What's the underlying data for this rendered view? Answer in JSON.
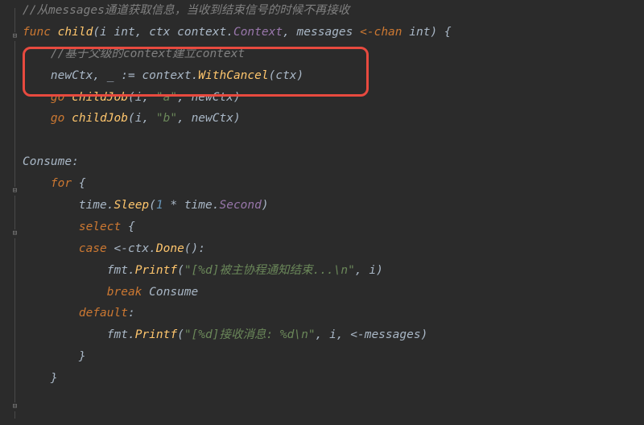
{
  "code": {
    "l5_comment": "//从messages通道获取信息，当收到结束信号的时候不再接收",
    "l6_func": "func",
    "l6_name": "child",
    "l6_p1": "i",
    "l6_t1": "int",
    "l6_p2": "ctx",
    "l6_t2a": "context",
    "l6_t2b": "Context",
    "l6_p3": "messages",
    "l6_chan": "<-chan",
    "l6_t3": "int",
    "l6_brace": ") {",
    "l7_comment": "//基于父级的context建立context",
    "l8_v1": "newCtx",
    "l8_v2": "_",
    "l8_op": ":=",
    "l8_pkg": "context",
    "l8_fn": "WithCancel",
    "l8_arg": "ctx",
    "l9_go": "go",
    "l9_fn": "childJob",
    "l9_a1": "i",
    "l9_a2": "\"a\"",
    "l9_a3": "newCtx",
    "l10_go": "go",
    "l10_fn": "childJob",
    "l10_a1": "i",
    "l10_a2": "\"b\"",
    "l10_a3": "newCtx",
    "l12_label": "Consume:",
    "l13_for": "for",
    "l13_brace": " {",
    "l14_pkg": "time",
    "l14_fn": "Sleep",
    "l14_n": "1",
    "l14_pkg2": "time",
    "l14_const": "Second",
    "l15_select": "select",
    "l15_brace": " {",
    "l16_case": "case",
    "l16_chan": " <-ctx.",
    "l16_done": "Done",
    "l16_end": "():",
    "l17_pkg": "fmt",
    "l17_fn": "Printf",
    "l17_str": "\"[%d]被主协程通知结束...\\n\"",
    "l17_arg": "i",
    "l18_break": "break",
    "l18_label": " Consume",
    "l19_default": "default",
    "l19_colon": ":",
    "l20_pkg": "fmt",
    "l20_fn": "Printf",
    "l20_str": "\"[%d]接收消息: %d\\n\"",
    "l20_a1": "i",
    "l20_a2": "<-messages",
    "l21_brace": "}",
    "l22_brace": "}"
  }
}
